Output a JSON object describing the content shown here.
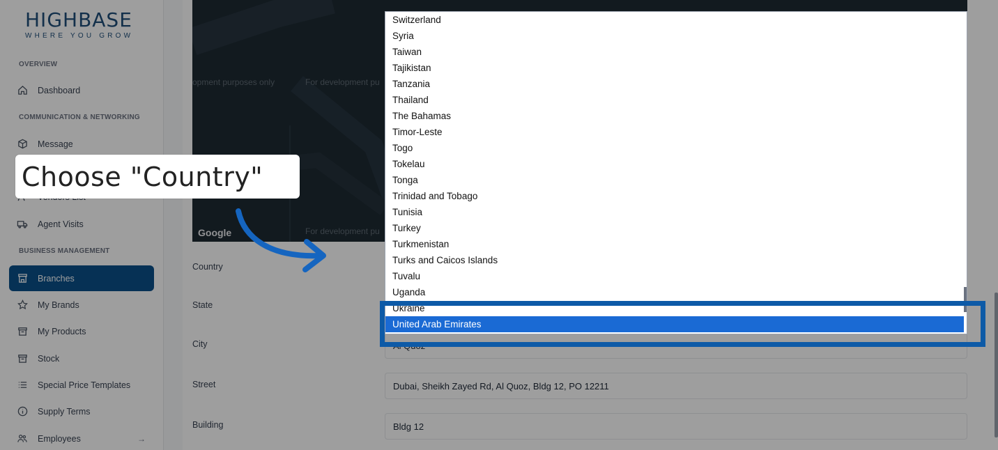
{
  "brand": {
    "name": "HIGHBASE",
    "tagline": "WHERE YOU GROW"
  },
  "sidebar": {
    "sections": [
      {
        "label": "OVERVIEW"
      },
      {
        "label": "COMMUNICATION & NETWORKING"
      },
      {
        "label": "BUSINESS MANAGEMENT"
      }
    ],
    "items": [
      {
        "label": "Dashboard",
        "icon": "home-icon"
      },
      {
        "label": "Message",
        "icon": "cube-icon"
      },
      {
        "label": "Vendors List",
        "icon": "users-icon"
      },
      {
        "label": "Agent Visits",
        "icon": "truck-icon"
      },
      {
        "label": "Branches",
        "icon": "store-icon",
        "active": true
      },
      {
        "label": "My Brands",
        "icon": "star-icon"
      },
      {
        "label": "My Products",
        "icon": "box-icon"
      },
      {
        "label": "Stock",
        "icon": "archive-icon"
      },
      {
        "label": "Special Price Templates",
        "icon": "list-icon"
      },
      {
        "label": "Supply Terms",
        "icon": "info-icon"
      },
      {
        "label": "Employees",
        "icon": "people-icon"
      }
    ]
  },
  "map": {
    "watermark": "For development purposes only",
    "watermark_partial": "opment purposes only",
    "watermark_cut": "For development pu",
    "google_label": "Google"
  },
  "form": {
    "labels": {
      "country": "Country",
      "state": "State",
      "city": "City",
      "street": "Street",
      "building": "Building"
    },
    "city_value": "Al Quoz",
    "street_value": "Dubai, Sheikh Zayed Rd, Al Quoz, Bldg 12, PO 12211",
    "building_value": "Bldg 12"
  },
  "dropdown": {
    "options": [
      "Switzerland",
      "Syria",
      "Taiwan",
      "Tajikistan",
      "Tanzania",
      "Thailand",
      "The Bahamas",
      "Timor-Leste",
      "Togo",
      "Tokelau",
      "Tonga",
      "Trinidad and Tobago",
      "Tunisia",
      "Turkey",
      "Turkmenistan",
      "Turks and Caicos Islands",
      "Tuvalu",
      "Uganda",
      "Ukraine",
      "United Arab Emirates"
    ],
    "selected": "United Arab Emirates"
  },
  "callout": {
    "text": "Choose \"Country\""
  },
  "colors": {
    "accent": "#0b4f8a",
    "selected": "#1a6ad4",
    "highlight": "#0d5aa7"
  }
}
